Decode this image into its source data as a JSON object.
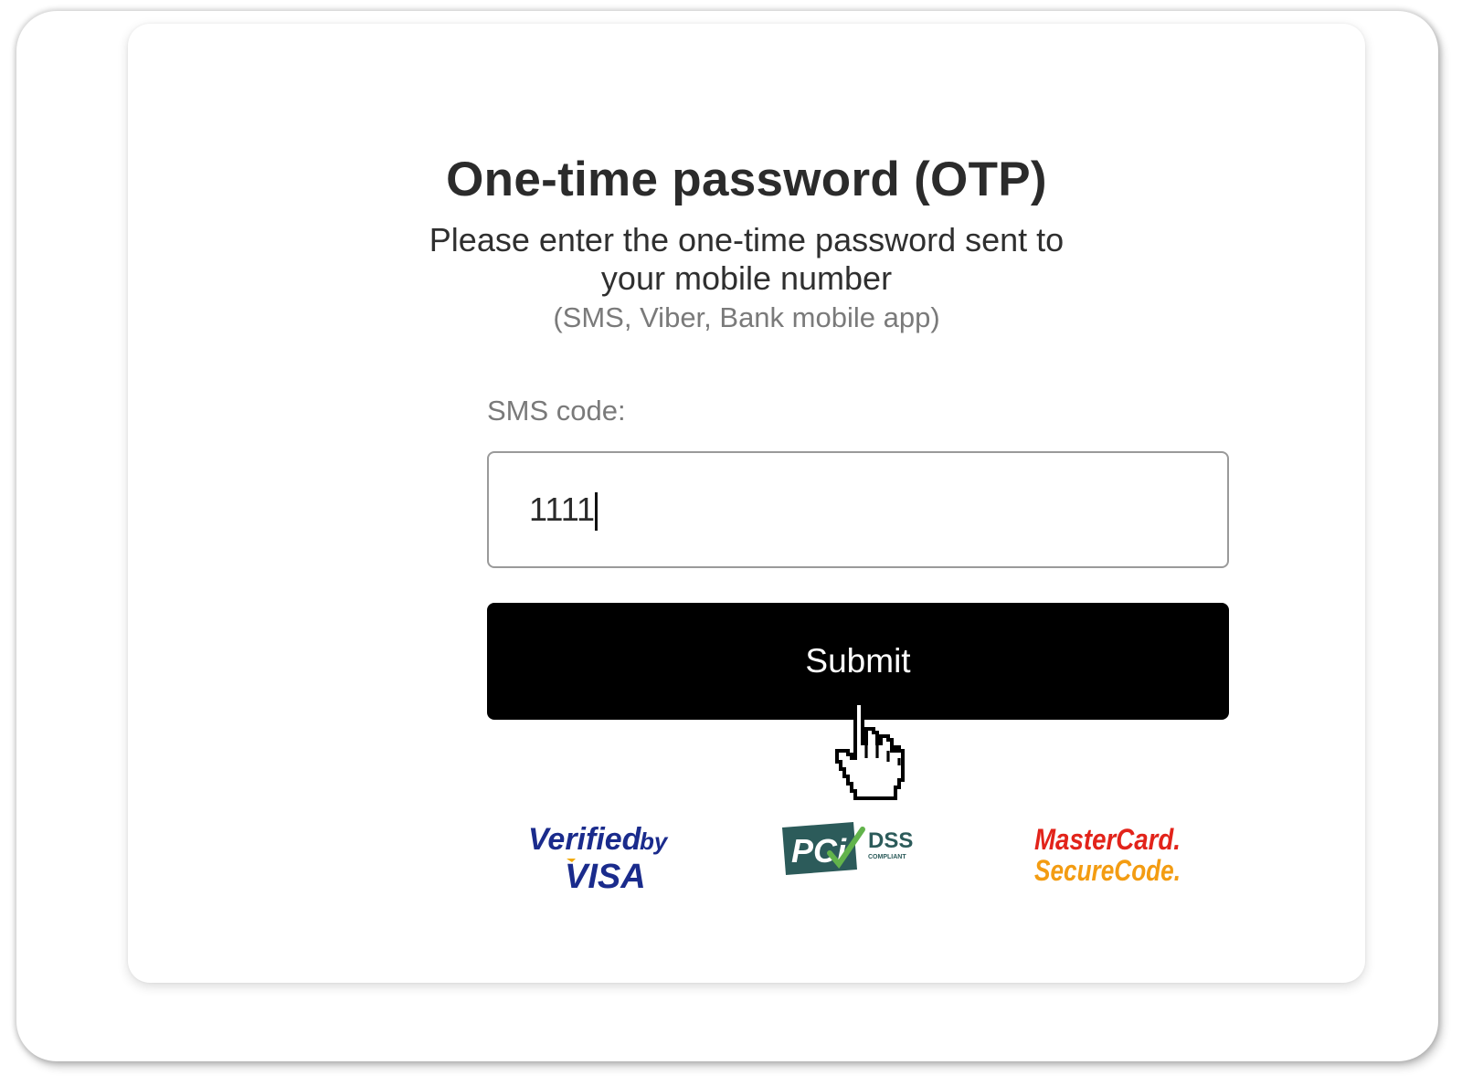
{
  "otp": {
    "title": "One-time password (OTP)",
    "description": "Please enter the one-time password sent to your mobile number",
    "channels": "(SMS, Viber, Bank mobile app)",
    "field_label": "SMS code:",
    "field_value": "1111",
    "submit_label": "Submit"
  },
  "badges": {
    "visa_line1": "Verified",
    "visa_by": "by",
    "visa_line2": "VISA",
    "pci_text": "PCi",
    "pci_dss": "DSS",
    "pci_compliant": "COMPLIANT",
    "mc_line1": "MasterCard.",
    "mc_line2": "SecureCode."
  },
  "colors": {
    "visa_blue": "#1a2b8c",
    "visa_gold": "#f2a900",
    "pci_teal": "#2c5b5a",
    "pci_green": "#62b34b",
    "mc_red": "#e2231a",
    "mc_orange": "#f39c12",
    "button_bg": "#000000"
  },
  "icons": {
    "cursor": "hand-pointer-icon"
  }
}
